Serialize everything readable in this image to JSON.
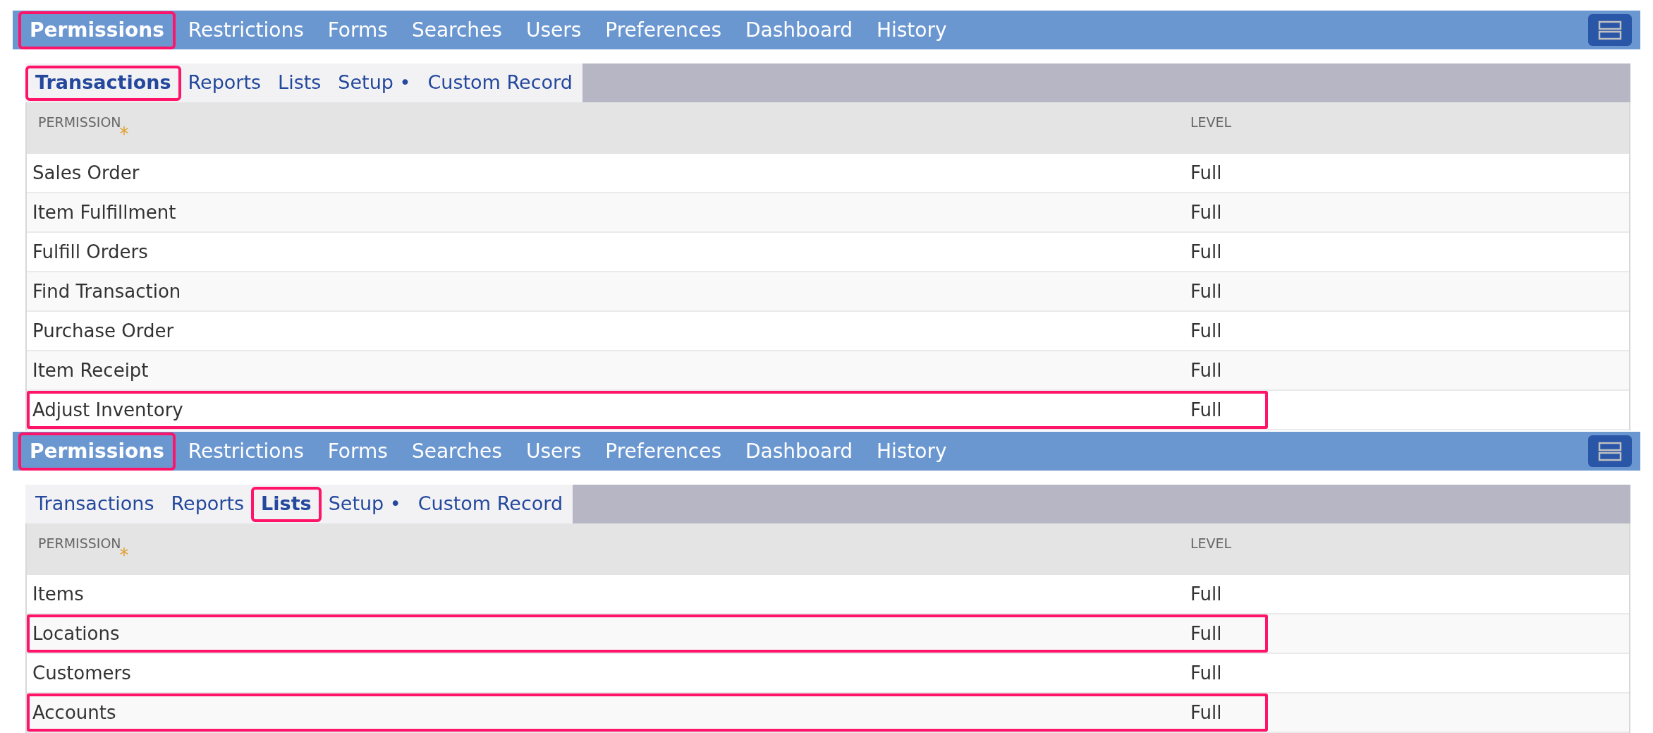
{
  "panels": [
    {
      "main_tabs": [
        {
          "label": "Permissions",
          "selected": true,
          "highlighted": true
        },
        {
          "label": "Restrictions",
          "selected": false,
          "highlighted": false
        },
        {
          "label": "Forms",
          "selected": false,
          "highlighted": false
        },
        {
          "label": "Searches",
          "selected": false,
          "highlighted": false
        },
        {
          "label": "Users",
          "selected": false,
          "highlighted": false
        },
        {
          "label": "Preferences",
          "selected": false,
          "highlighted": false
        },
        {
          "label": "Dashboard",
          "selected": false,
          "highlighted": false
        },
        {
          "label": "History",
          "selected": false,
          "highlighted": false
        }
      ],
      "sub_tabs": [
        {
          "label": "Transactions",
          "selected": true,
          "highlighted": true
        },
        {
          "label": "Reports",
          "selected": false,
          "highlighted": false
        },
        {
          "label": "Lists",
          "selected": false,
          "highlighted": false
        },
        {
          "label": "Setup •",
          "selected": false,
          "highlighted": false
        },
        {
          "label": "Custom Record",
          "selected": false,
          "highlighted": false
        }
      ],
      "columns": [
        "PERMISSION",
        "LEVEL"
      ],
      "required_mark": "*",
      "rows": [
        {
          "permission": "Sales Order",
          "level": "Full",
          "highlighted": false
        },
        {
          "permission": "Item Fulfillment",
          "level": "Full",
          "highlighted": false
        },
        {
          "permission": "Fulfill Orders",
          "level": "Full",
          "highlighted": false
        },
        {
          "permission": "Find Transaction",
          "level": "Full",
          "highlighted": false
        },
        {
          "permission": "Purchase Order",
          "level": "Full",
          "highlighted": false
        },
        {
          "permission": "Item Receipt",
          "level": "Full",
          "highlighted": false
        },
        {
          "permission": "Adjust Inventory",
          "level": "Full",
          "highlighted": true
        }
      ]
    },
    {
      "main_tabs": [
        {
          "label": "Permissions",
          "selected": true,
          "highlighted": true
        },
        {
          "label": "Restrictions",
          "selected": false,
          "highlighted": false
        },
        {
          "label": "Forms",
          "selected": false,
          "highlighted": false
        },
        {
          "label": "Searches",
          "selected": false,
          "highlighted": false
        },
        {
          "label": "Users",
          "selected": false,
          "highlighted": false
        },
        {
          "label": "Preferences",
          "selected": false,
          "highlighted": false
        },
        {
          "label": "Dashboard",
          "selected": false,
          "highlighted": false
        },
        {
          "label": "History",
          "selected": false,
          "highlighted": false
        }
      ],
      "sub_tabs": [
        {
          "label": "Transactions",
          "selected": false,
          "highlighted": false
        },
        {
          "label": "Reports",
          "selected": false,
          "highlighted": false
        },
        {
          "label": "Lists",
          "selected": true,
          "highlighted": true
        },
        {
          "label": "Setup •",
          "selected": false,
          "highlighted": false
        },
        {
          "label": "Custom Record",
          "selected": false,
          "highlighted": false
        }
      ],
      "columns": [
        "PERMISSION",
        "LEVEL"
      ],
      "required_mark": "*",
      "rows": [
        {
          "permission": "Items",
          "level": "Full",
          "highlighted": false
        },
        {
          "permission": "Locations",
          "level": "Full",
          "highlighted": true
        },
        {
          "permission": "Customers",
          "level": "Full",
          "highlighted": false
        },
        {
          "permission": "Accounts",
          "level": "Full",
          "highlighted": true
        }
      ]
    }
  ]
}
